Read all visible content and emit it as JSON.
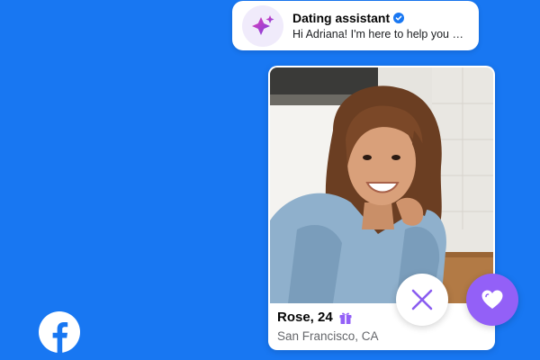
{
  "notification": {
    "title": "Dating assistant",
    "message": "Hi Adriana! I'm here to help you wi...",
    "verified_icon": "verified-badge-icon",
    "avatar_icon": "sparkle-icon"
  },
  "profile": {
    "name": "Rose, 24",
    "location": "San Francisco, CA",
    "badge_icon": "gift-icon"
  },
  "actions": {
    "pass_icon": "close-icon",
    "like_icon": "heart-icon"
  },
  "brand": {
    "logo_icon": "facebook-logo-icon"
  },
  "colors": {
    "background": "#1877F2",
    "accent_purple": "#9360f7",
    "verified_blue": "#1877F2",
    "text_secondary": "#65676b"
  }
}
